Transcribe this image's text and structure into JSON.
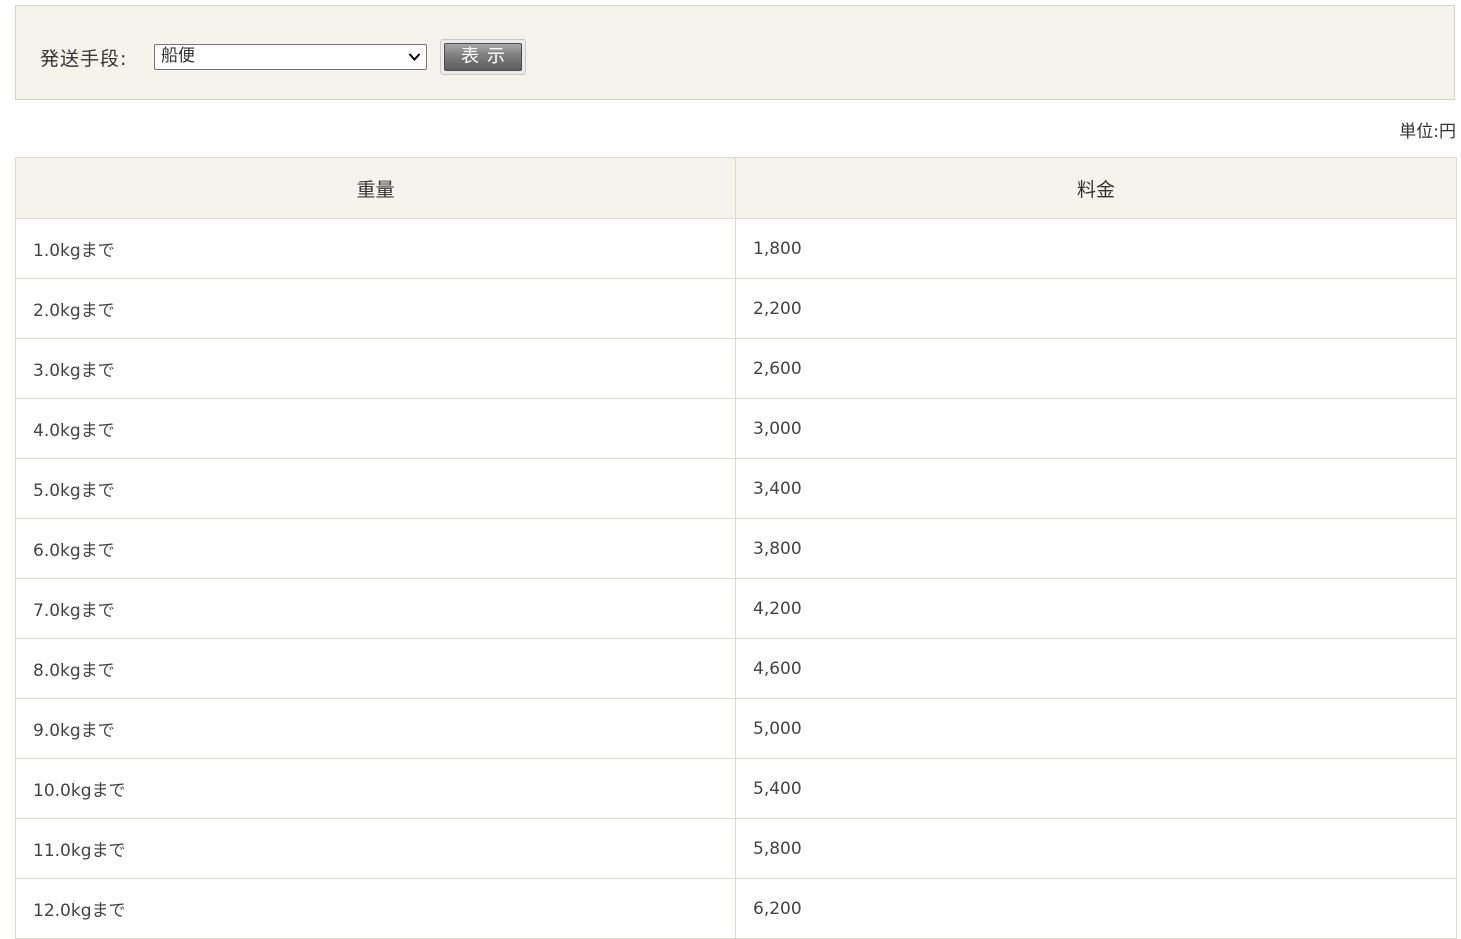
{
  "filter": {
    "label": "発送手段:",
    "select_value": "船便",
    "submit_label": "表示"
  },
  "unit_label": "単位:円",
  "table": {
    "headers": {
      "weight": "重量",
      "price": "料金"
    },
    "rows": [
      {
        "weight": "1.0kgまで",
        "price": "1,800"
      },
      {
        "weight": "2.0kgまで",
        "price": "2,200"
      },
      {
        "weight": "3.0kgまで",
        "price": "2,600"
      },
      {
        "weight": "4.0kgまで",
        "price": "3,000"
      },
      {
        "weight": "5.0kgまで",
        "price": "3,400"
      },
      {
        "weight": "6.0kgまで",
        "price": "3,800"
      },
      {
        "weight": "7.0kgまで",
        "price": "4,200"
      },
      {
        "weight": "8.0kgまで",
        "price": "4,600"
      },
      {
        "weight": "9.0kgまで",
        "price": "5,000"
      },
      {
        "weight": "10.0kgまで",
        "price": "5,400"
      },
      {
        "weight": "11.0kgまで",
        "price": "5,800"
      },
      {
        "weight": "12.0kgまで",
        "price": "6,200"
      }
    ]
  },
  "colors": {
    "panel_bg": "#f5f4ec",
    "border": "#dcdacd",
    "button_dark": "#5a5a5a"
  },
  "icons": {
    "select_arrow": "chevron-down-icon"
  }
}
